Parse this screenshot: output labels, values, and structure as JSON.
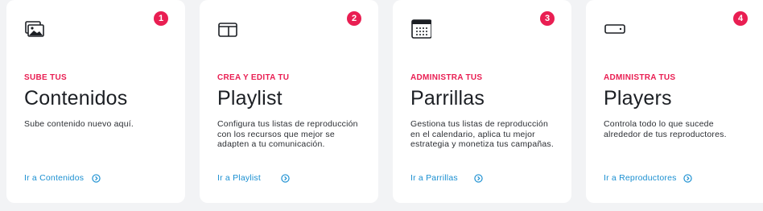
{
  "cards": [
    {
      "badge": "1",
      "icon": "image-gallery-icon",
      "kicker": "SUBE TUS",
      "title": "Contenidos",
      "description": "Sube contenido nuevo aquí.",
      "link": "Ir a Contenidos"
    },
    {
      "badge": "2",
      "icon": "layout-icon",
      "kicker": "CREA Y EDITA TU",
      "title": "Playlist",
      "description": "Configura tus listas de reproducción con los recursos que mejor se adapten a tu comunicación.",
      "link": "Ir a Playlist"
    },
    {
      "badge": "3",
      "icon": "calendar-icon",
      "kicker": "ADMINISTRA TUS",
      "title": "Parrillas",
      "description": "Gestiona tus listas de reproducción en el calendario, aplica tu mejor estrategia y monetiza tus campañas.",
      "link": "Ir a Parrillas"
    },
    {
      "badge": "4",
      "icon": "player-device-icon",
      "kicker": "ADMINISTRA TUS",
      "title": "Players",
      "description": "Controla todo lo que sucede alrededor de tus reproductores.",
      "link": "Ir a Reproductores"
    }
  ],
  "colors": {
    "accent": "#e91e52",
    "link": "#1a8fd1",
    "text": "#1c1f24",
    "background": "#f2f3f5"
  }
}
